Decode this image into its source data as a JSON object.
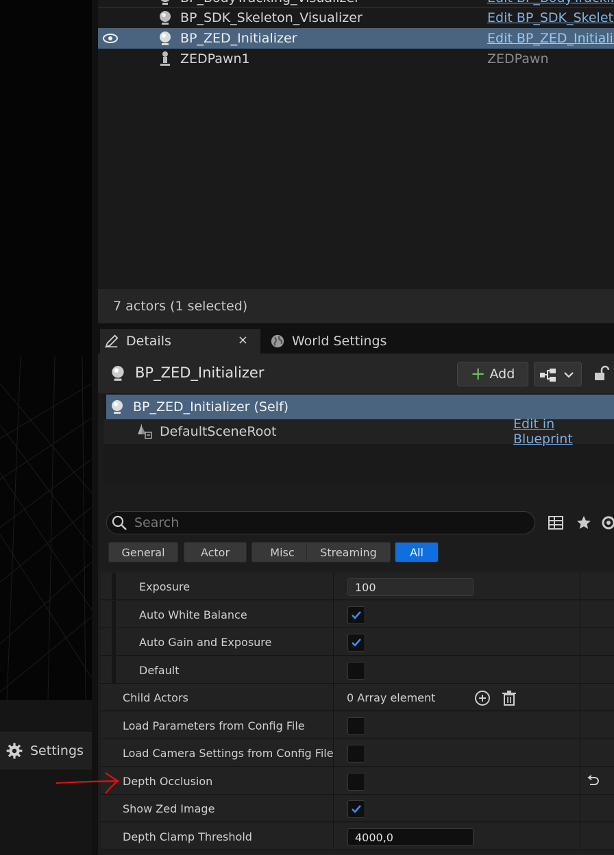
{
  "viewport": {
    "settings_label": "Settings"
  },
  "outliner": {
    "rows": [
      {
        "name": "BP_BodyTracking_Visualizer",
        "type": "Edit BP_BodyTrackin",
        "selected": false
      },
      {
        "name": "BP_SDK_Skeleton_Visualizer",
        "type": "Edit BP_SDK_Skeleto",
        "selected": false
      },
      {
        "name": "BP_ZED_Initializer",
        "type": "Edit BP_ZED_Initializ",
        "selected": true
      },
      {
        "name": "ZEDPawn1",
        "type": "ZEDPawn",
        "selected": false
      }
    ],
    "status": "7 actors (1 selected)"
  },
  "tabs": {
    "details": "Details",
    "close": "×",
    "world_settings": "World Settings"
  },
  "details": {
    "title": "BP_ZED_Initializer",
    "add_label": "Add",
    "components": {
      "self": "BP_ZED_Initializer (Self)",
      "root": "DefaultSceneRoot",
      "edit_link": "Edit in Blueprint"
    },
    "search": {
      "placeholder": "Search",
      "value": ""
    },
    "filters": [
      "General",
      "Actor",
      "Misc",
      "Streaming",
      "All"
    ],
    "active_filter": "All",
    "properties": {
      "exposure": {
        "label": "Exposure",
        "value": "100"
      },
      "auto_white_balance": {
        "label": "Auto White Balance",
        "checked": true
      },
      "auto_gain": {
        "label": "Auto Gain and Exposure",
        "checked": true
      },
      "default": {
        "label": "Default",
        "checked": false
      },
      "child_actors": {
        "label": "Child Actors",
        "value": "0 Array element"
      },
      "load_params": {
        "label": "Load Parameters from Config File",
        "checked": false
      },
      "load_camera": {
        "label": "Load Camera Settings from Config File",
        "checked": false
      },
      "depth_occlusion": {
        "label": "Depth Occlusion",
        "checked": false
      },
      "show_zed": {
        "label": "Show Zed Image",
        "checked": true
      },
      "depth_clamp": {
        "label": "Depth Clamp Threshold",
        "value": "4000,0"
      }
    }
  },
  "colors": {
    "selection": "#4a6480",
    "link": "#7fb0e6",
    "active_filter": "#0e70e0",
    "add_plus": "#6ec25a",
    "annotation_arrow": "#e01010"
  }
}
